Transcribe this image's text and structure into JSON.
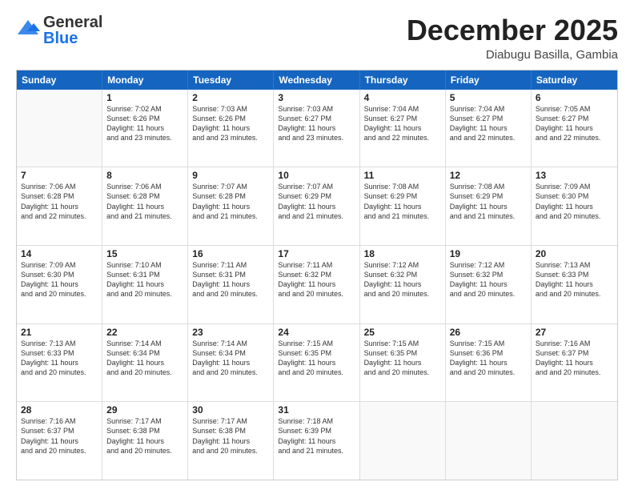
{
  "header": {
    "logo_general": "General",
    "logo_blue": "Blue",
    "month_title": "December 2025",
    "location": "Diabugu Basilla, Gambia"
  },
  "weekdays": [
    "Sunday",
    "Monday",
    "Tuesday",
    "Wednesday",
    "Thursday",
    "Friday",
    "Saturday"
  ],
  "rows": [
    [
      {
        "day": "",
        "sunrise": "",
        "sunset": "",
        "daylight": "",
        "empty": true
      },
      {
        "day": "1",
        "sunrise": "Sunrise: 7:02 AM",
        "sunset": "Sunset: 6:26 PM",
        "daylight": "Daylight: 11 hours and 23 minutes."
      },
      {
        "day": "2",
        "sunrise": "Sunrise: 7:03 AM",
        "sunset": "Sunset: 6:26 PM",
        "daylight": "Daylight: 11 hours and 23 minutes."
      },
      {
        "day": "3",
        "sunrise": "Sunrise: 7:03 AM",
        "sunset": "Sunset: 6:27 PM",
        "daylight": "Daylight: 11 hours and 23 minutes."
      },
      {
        "day": "4",
        "sunrise": "Sunrise: 7:04 AM",
        "sunset": "Sunset: 6:27 PM",
        "daylight": "Daylight: 11 hours and 22 minutes."
      },
      {
        "day": "5",
        "sunrise": "Sunrise: 7:04 AM",
        "sunset": "Sunset: 6:27 PM",
        "daylight": "Daylight: 11 hours and 22 minutes."
      },
      {
        "day": "6",
        "sunrise": "Sunrise: 7:05 AM",
        "sunset": "Sunset: 6:27 PM",
        "daylight": "Daylight: 11 hours and 22 minutes."
      }
    ],
    [
      {
        "day": "7",
        "sunrise": "Sunrise: 7:06 AM",
        "sunset": "Sunset: 6:28 PM",
        "daylight": "Daylight: 11 hours and 22 minutes."
      },
      {
        "day": "8",
        "sunrise": "Sunrise: 7:06 AM",
        "sunset": "Sunset: 6:28 PM",
        "daylight": "Daylight: 11 hours and 21 minutes."
      },
      {
        "day": "9",
        "sunrise": "Sunrise: 7:07 AM",
        "sunset": "Sunset: 6:28 PM",
        "daylight": "Daylight: 11 hours and 21 minutes."
      },
      {
        "day": "10",
        "sunrise": "Sunrise: 7:07 AM",
        "sunset": "Sunset: 6:29 PM",
        "daylight": "Daylight: 11 hours and 21 minutes."
      },
      {
        "day": "11",
        "sunrise": "Sunrise: 7:08 AM",
        "sunset": "Sunset: 6:29 PM",
        "daylight": "Daylight: 11 hours and 21 minutes."
      },
      {
        "day": "12",
        "sunrise": "Sunrise: 7:08 AM",
        "sunset": "Sunset: 6:29 PM",
        "daylight": "Daylight: 11 hours and 21 minutes."
      },
      {
        "day": "13",
        "sunrise": "Sunrise: 7:09 AM",
        "sunset": "Sunset: 6:30 PM",
        "daylight": "Daylight: 11 hours and 20 minutes."
      }
    ],
    [
      {
        "day": "14",
        "sunrise": "Sunrise: 7:09 AM",
        "sunset": "Sunset: 6:30 PM",
        "daylight": "Daylight: 11 hours and 20 minutes."
      },
      {
        "day": "15",
        "sunrise": "Sunrise: 7:10 AM",
        "sunset": "Sunset: 6:31 PM",
        "daylight": "Daylight: 11 hours and 20 minutes."
      },
      {
        "day": "16",
        "sunrise": "Sunrise: 7:11 AM",
        "sunset": "Sunset: 6:31 PM",
        "daylight": "Daylight: 11 hours and 20 minutes."
      },
      {
        "day": "17",
        "sunrise": "Sunrise: 7:11 AM",
        "sunset": "Sunset: 6:32 PM",
        "daylight": "Daylight: 11 hours and 20 minutes."
      },
      {
        "day": "18",
        "sunrise": "Sunrise: 7:12 AM",
        "sunset": "Sunset: 6:32 PM",
        "daylight": "Daylight: 11 hours and 20 minutes."
      },
      {
        "day": "19",
        "sunrise": "Sunrise: 7:12 AM",
        "sunset": "Sunset: 6:32 PM",
        "daylight": "Daylight: 11 hours and 20 minutes."
      },
      {
        "day": "20",
        "sunrise": "Sunrise: 7:13 AM",
        "sunset": "Sunset: 6:33 PM",
        "daylight": "Daylight: 11 hours and 20 minutes."
      }
    ],
    [
      {
        "day": "21",
        "sunrise": "Sunrise: 7:13 AM",
        "sunset": "Sunset: 6:33 PM",
        "daylight": "Daylight: 11 hours and 20 minutes."
      },
      {
        "day": "22",
        "sunrise": "Sunrise: 7:14 AM",
        "sunset": "Sunset: 6:34 PM",
        "daylight": "Daylight: 11 hours and 20 minutes."
      },
      {
        "day": "23",
        "sunrise": "Sunrise: 7:14 AM",
        "sunset": "Sunset: 6:34 PM",
        "daylight": "Daylight: 11 hours and 20 minutes."
      },
      {
        "day": "24",
        "sunrise": "Sunrise: 7:15 AM",
        "sunset": "Sunset: 6:35 PM",
        "daylight": "Daylight: 11 hours and 20 minutes."
      },
      {
        "day": "25",
        "sunrise": "Sunrise: 7:15 AM",
        "sunset": "Sunset: 6:35 PM",
        "daylight": "Daylight: 11 hours and 20 minutes."
      },
      {
        "day": "26",
        "sunrise": "Sunrise: 7:15 AM",
        "sunset": "Sunset: 6:36 PM",
        "daylight": "Daylight: 11 hours and 20 minutes."
      },
      {
        "day": "27",
        "sunrise": "Sunrise: 7:16 AM",
        "sunset": "Sunset: 6:37 PM",
        "daylight": "Daylight: 11 hours and 20 minutes."
      }
    ],
    [
      {
        "day": "28",
        "sunrise": "Sunrise: 7:16 AM",
        "sunset": "Sunset: 6:37 PM",
        "daylight": "Daylight: 11 hours and 20 minutes."
      },
      {
        "day": "29",
        "sunrise": "Sunrise: 7:17 AM",
        "sunset": "Sunset: 6:38 PM",
        "daylight": "Daylight: 11 hours and 20 minutes."
      },
      {
        "day": "30",
        "sunrise": "Sunrise: 7:17 AM",
        "sunset": "Sunset: 6:38 PM",
        "daylight": "Daylight: 11 hours and 20 minutes."
      },
      {
        "day": "31",
        "sunrise": "Sunrise: 7:18 AM",
        "sunset": "Sunset: 6:39 PM",
        "daylight": "Daylight: 11 hours and 21 minutes."
      },
      {
        "day": "",
        "sunrise": "",
        "sunset": "",
        "daylight": "",
        "empty": true
      },
      {
        "day": "",
        "sunrise": "",
        "sunset": "",
        "daylight": "",
        "empty": true
      },
      {
        "day": "",
        "sunrise": "",
        "sunset": "",
        "daylight": "",
        "empty": true
      }
    ]
  ]
}
